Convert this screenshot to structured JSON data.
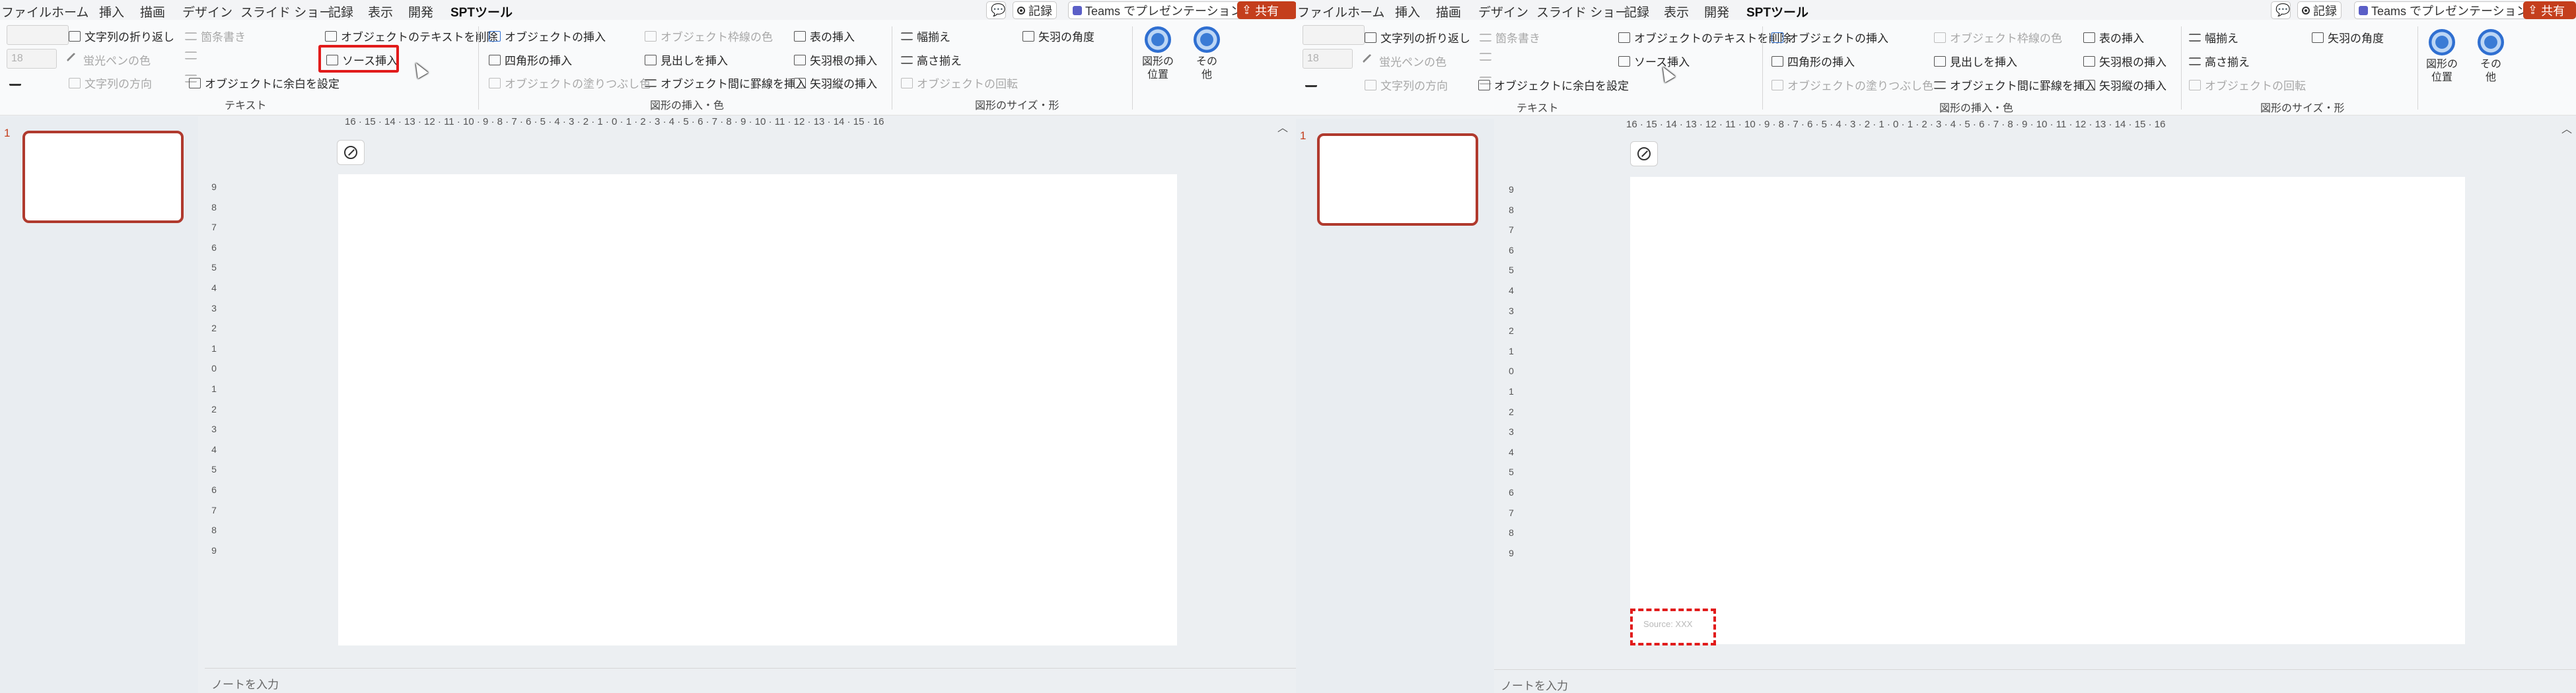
{
  "tabs": [
    "ファイル",
    "ホーム",
    "挿入",
    "描画",
    "デザイン",
    "スライド ショー",
    "記録",
    "表示",
    "開発",
    "SPTツール"
  ],
  "active_tab": "SPTツール",
  "window_buttons": {
    "comments_icon": "comment-icon",
    "record": "記録",
    "teams": "Teams でプレゼンテーション",
    "share": "共有"
  },
  "ribbon": {
    "font_size": "18",
    "text_group": {
      "wrap_text": "文字列の折り返し",
      "pen_color": "蛍光ペンの色",
      "text_direction": "文字列の方向",
      "bullets": "箇条書き",
      "delete_object_text": "オブジェクトのテキストを削除",
      "source_insert": "ソース挿入",
      "set_object_margins": "オブジェクトに余白を設定",
      "label": "テキスト"
    },
    "insert_group": {
      "insert_object": "オブジェクトの挿入",
      "insert_rectangle": "四角形の挿入",
      "fill_color": "オブジェクトの塗りつぶし色",
      "border_color": "オブジェクト枠線の色",
      "insert_heading": "見出しを挿入",
      "insert_ruled_lines": "オブジェクト間に罫線を挿入",
      "insert_table": "表の挿入",
      "insert_arrow": "矢羽根の挿入",
      "insert_vertical_arrow": "矢羽縦の挿入",
      "label": "図形の挿入・色"
    },
    "size_group": {
      "align_width": "幅揃え",
      "align_height": "高さ揃え",
      "rotate_object": "オブジェクトの回転",
      "arrow_angle": "矢羽の角度",
      "label": "図形のサイズ・形"
    },
    "shape_position": "図形の\n位置",
    "other": "その\n他"
  },
  "slide_number": "1",
  "ruler_h": "16 · 15 · 14 · 13 · 12 · 11 · 10 · 9 · 8 · 7 · 6 · 5 · 4 · 3 · 2 · 1 · 0 · 1 · 2 · 3 · 4 · 5 · 6 · 7 · 8 · 9 · 10 · 11 · 12 · 13 · 14 · 15 · 16",
  "ruler_v": [
    "9",
    "8",
    "7",
    "6",
    "5",
    "4",
    "3",
    "2",
    "1",
    "0",
    "1",
    "2",
    "3",
    "4",
    "5",
    "6",
    "7",
    "8",
    "9"
  ],
  "notes_placeholder": "ノートを入力",
  "source_placeholder": "Source: XXX",
  "colors": {
    "accent": "#c43e1c",
    "highlight": "#e11b1b",
    "thumb_border": "#b03a2e"
  }
}
